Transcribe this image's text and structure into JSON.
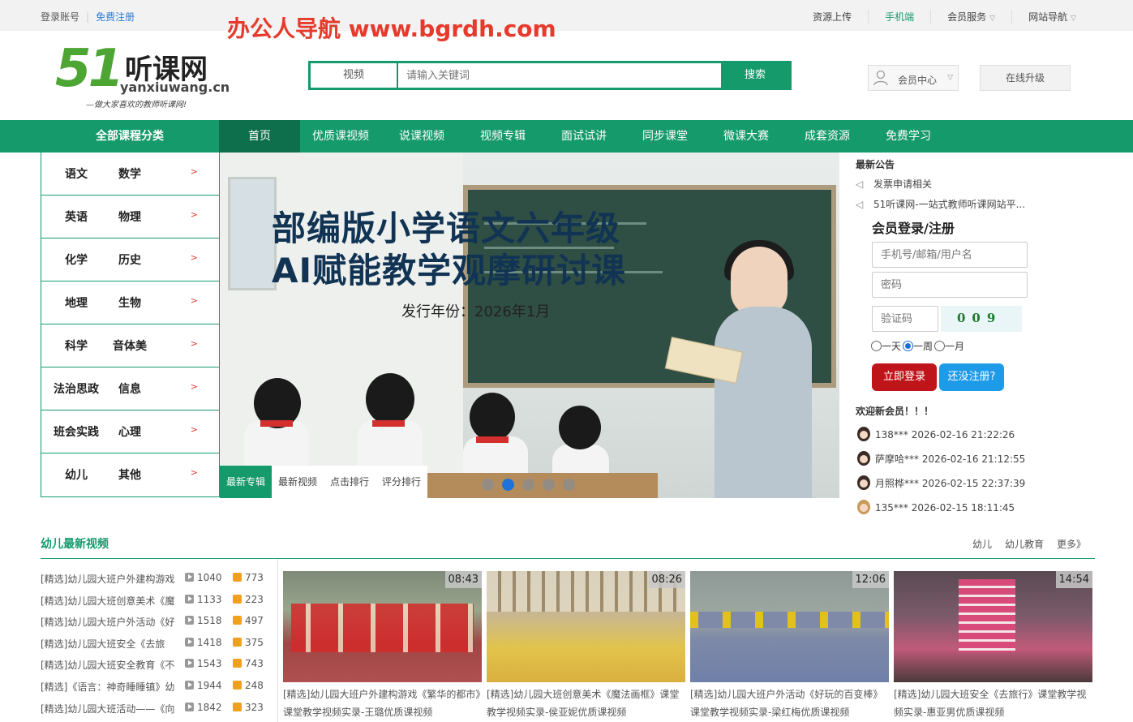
{
  "topbar": {
    "login": "登录账号",
    "register": "免费注册",
    "watermark": "办公人导航  www.bgrdh.com",
    "upload": "资源上传",
    "mobile": "手机端",
    "member_service": "会员服务",
    "site_nav": "网站导航"
  },
  "logo": {
    "num": "51",
    "title": "听课网",
    "domain": "yanxiuwang.cn",
    "slogan": "—做大家喜欢的教师听课网!"
  },
  "search": {
    "category": "视频",
    "placeholder": "请输入关键词",
    "button": "搜索"
  },
  "header": {
    "member_center": "会员中心",
    "upgrade": "在线升级"
  },
  "nav": {
    "all": "全部课程分类",
    "items": [
      "首页",
      "优质课视频",
      "说课视频",
      "视频专辑",
      "面试试讲",
      "同步课堂",
      "微课大赛",
      "成套资源",
      "免费学习"
    ]
  },
  "categories": [
    {
      "a": "语文",
      "b": "数学"
    },
    {
      "a": "英语",
      "b": "物理"
    },
    {
      "a": "化学",
      "b": "历史"
    },
    {
      "a": "地理",
      "b": "生物"
    },
    {
      "a": "科学",
      "b": "音体美"
    },
    {
      "a": "法治思政",
      "b": "信息"
    },
    {
      "a": "班会实践",
      "b": "心理"
    },
    {
      "a": "幼儿",
      "b": "其他"
    }
  ],
  "category_arrow": ">",
  "banner": {
    "line1": "部编版小学语文六年级",
    "line2": "AI赋能教学观摩研讨课",
    "line3": "发行年份：2026年1月",
    "tabs": [
      "最新专辑",
      "最新视频",
      "点击排行",
      "评分排行"
    ]
  },
  "notices": {
    "heading": "最新公告",
    "items": [
      "发票申请相关",
      "51听课网-一站式教师听课网站平..."
    ]
  },
  "login": {
    "heading": "会员登录/注册",
    "user_placeholder": "手机号/邮箱/用户名",
    "pwd_placeholder": "密码",
    "captcha_placeholder": "验证码",
    "captcha_code": "009",
    "radios": [
      "一天",
      "一周",
      "一月"
    ],
    "login_btn": "立即登录",
    "reg_btn": "还没注册?"
  },
  "new_members": {
    "heading": "欢迎新会员！！！",
    "items": [
      "138*** 2026-02-16 21:22:26",
      "萨摩哈*** 2026-02-16 21:12:55",
      "月照桦*** 2026-02-15 22:37:39",
      "135*** 2026-02-15 18:11:45"
    ]
  },
  "section": {
    "title": "幼儿最新视频",
    "links": [
      "幼儿",
      "幼儿教育",
      "更多》"
    ],
    "list": [
      {
        "title": "[精选]幼儿园大班户外建构游戏",
        "views": "1040",
        "comments": "773"
      },
      {
        "title": "[精选]幼儿园大班创意美术《魔",
        "views": "1133",
        "comments": "223"
      },
      {
        "title": "[精选]幼儿园大班户外活动《好",
        "views": "1518",
        "comments": "497"
      },
      {
        "title": "[精选]幼儿园大班安全《去旅",
        "views": "1418",
        "comments": "375"
      },
      {
        "title": "[精选]幼儿园大班安全教育《不",
        "views": "1543",
        "comments": "743"
      },
      {
        "title": "[精选]《语言：神奇睡睡镇》幼",
        "views": "1944",
        "comments": "248"
      },
      {
        "title": "[精选]幼儿园大班活动——《向",
        "views": "1842",
        "comments": "323"
      }
    ],
    "cards": [
      {
        "duration": "08:43",
        "caption": "[精选]幼儿园大班户外建构游戏《繁华的都市》课堂教学视频实录-王璐优质课视频"
      },
      {
        "duration": "08:26",
        "caption": "[精选]幼儿园大班创意美术《魔法画框》课堂教学视频实录-侯亚妮优质课视频"
      },
      {
        "duration": "12:06",
        "caption": "[精选]幼儿园大班户外活动《好玩的百变棒》课堂教学视频实录-梁红梅优质课视频"
      },
      {
        "duration": "14:54",
        "caption": "[精选]幼儿园大班安全《去旅行》课堂教学视频实录-惠亚男优质课视频"
      }
    ]
  },
  "colors": {
    "brand": "#159a6c",
    "accent_red": "#c0141b",
    "accent_blue": "#1e9be8"
  }
}
